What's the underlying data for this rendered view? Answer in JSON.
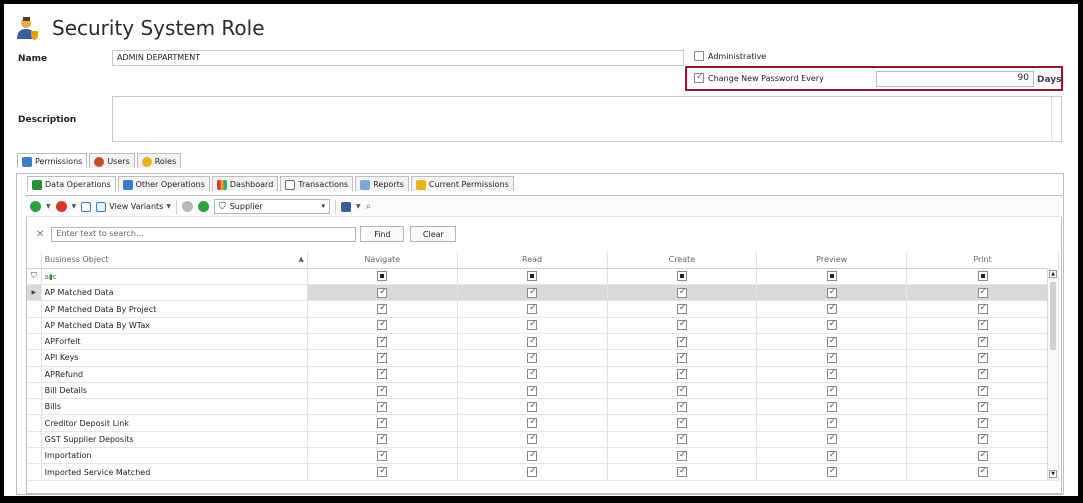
{
  "header": {
    "title": "Security System Role",
    "icon": "user-shield-icon"
  },
  "form": {
    "name_label": "Name",
    "name_value": "ADMIN DEPARTMENT",
    "administrative_label": "Administrative",
    "administrative_checked": false,
    "change_password_label": "Change New Password Every",
    "change_password_checked": true,
    "days_value": "90",
    "days_label": "Days",
    "description_label": "Description",
    "description_value": ""
  },
  "outer_tabs": [
    {
      "label": "Permissions",
      "icon": "permissions-icon",
      "active": true
    },
    {
      "label": "Users",
      "icon": "users-icon",
      "active": false
    },
    {
      "label": "Roles",
      "icon": "roles-icon",
      "active": false
    }
  ],
  "inner_tabs": [
    {
      "label": "Data Operations",
      "icon": "data-operations-icon",
      "active": true
    },
    {
      "label": "Other Operations",
      "icon": "other-operations-icon",
      "active": false
    },
    {
      "label": "Dashboard",
      "icon": "dashboard-icon",
      "active": false
    },
    {
      "label": "Transactions",
      "icon": "transactions-icon",
      "active": false
    },
    {
      "label": "Reports",
      "icon": "reports-icon",
      "active": false
    },
    {
      "label": "Current Permissions",
      "icon": "current-permissions-icon",
      "active": false
    }
  ],
  "toolbar": {
    "view_variants_label": "View Variants",
    "filter_value": "Supplier"
  },
  "search": {
    "placeholder": "Enter text to search...",
    "find_label": "Find",
    "clear_label": "Clear"
  },
  "grid": {
    "columns": [
      "Business Object",
      "Navigate",
      "Read",
      "Create",
      "Preview",
      "Print"
    ],
    "filter_row_text": "",
    "rows": [
      {
        "name": "AP Matched Data",
        "selected": true
      },
      {
        "name": "AP Matched Data By Project",
        "selected": false
      },
      {
        "name": "AP Matched Data By WTax",
        "selected": false
      },
      {
        "name": "APForfeit",
        "selected": false
      },
      {
        "name": "API Keys",
        "selected": false
      },
      {
        "name": "APRefund",
        "selected": false
      },
      {
        "name": "Bill Details",
        "selected": false
      },
      {
        "name": "Bills",
        "selected": false
      },
      {
        "name": "Creditor Deposit Link",
        "selected": false
      },
      {
        "name": "GST Supplier Deposits",
        "selected": false
      },
      {
        "name": "Importation",
        "selected": false
      },
      {
        "name": "Imported Service Matched",
        "selected": false
      }
    ]
  },
  "colors": {
    "highlight_border": "#8b1a2a",
    "days_text": "#3b3b70",
    "selected_row": "#d9d9d9"
  }
}
